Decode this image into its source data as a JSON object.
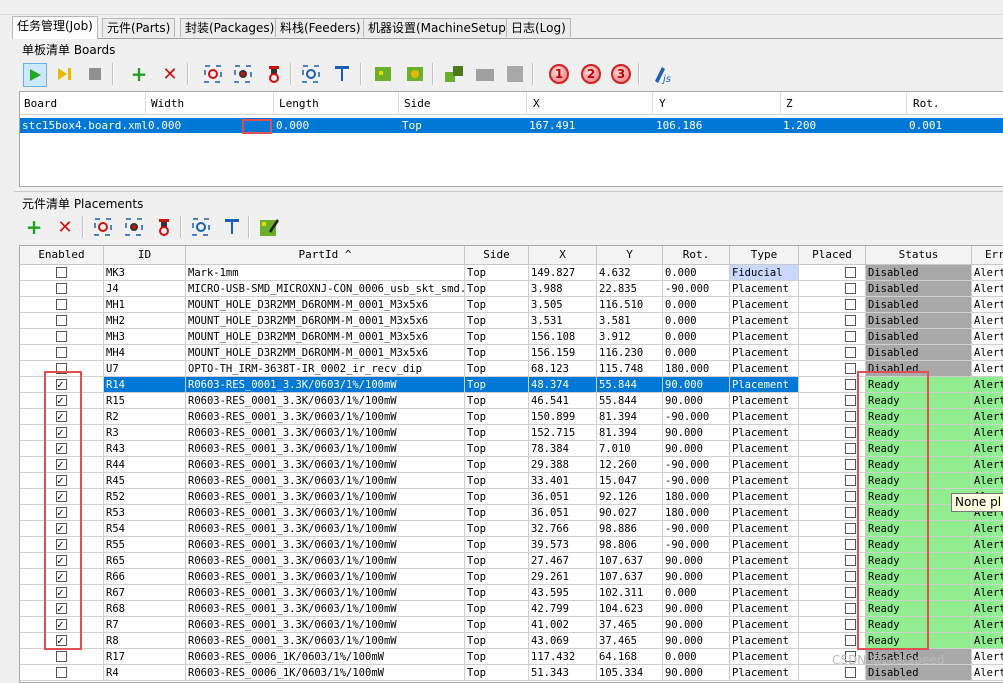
{
  "tabs": [
    "任务管理(Job)",
    "元件(Parts)",
    "封装(Packages)",
    "料栈(Feeders)",
    "机器设置(MachineSetup)",
    "日志(Log)"
  ],
  "boards_panel": {
    "title": "单板清单 Boards",
    "columns": [
      "Board",
      "Width",
      "Length",
      "Side",
      "X",
      "Y",
      "Z",
      "Rot."
    ],
    "row": [
      "stc15box4.board.xml",
      "0.000",
      "",
      "0.000",
      "Top",
      "167.491",
      "106.186",
      "1.200",
      "0.001"
    ]
  },
  "placements_panel": {
    "title": "元件清单 Placements",
    "columns": [
      "Enabled",
      "ID",
      "PartId ^",
      "Side",
      "X",
      "Y",
      "Rot.",
      "Type",
      "Placed",
      "Status",
      "Error"
    ],
    "rows": [
      {
        "enabled": false,
        "id": "MK3",
        "part": "Mark-1mm",
        "side": "Top",
        "x": "149.827",
        "y": "4.632",
        "rot": "0.000",
        "type": "Fiducial",
        "placed": false,
        "status": "Disabled",
        "error": "Alert"
      },
      {
        "enabled": false,
        "id": "J4",
        "part": "MICRO-USB-SMD_MICROXNJ-CON_0006_usb_skt_smd...",
        "side": "Top",
        "x": "3.988",
        "y": "22.835",
        "rot": "-90.000",
        "type": "Placement",
        "placed": false,
        "status": "Disabled",
        "error": "Alert"
      },
      {
        "enabled": false,
        "id": "MH1",
        "part": "MOUNT_HOLE_D3R2MM_D6ROMM-M_0001_M3x5x6",
        "side": "Top",
        "x": "3.505",
        "y": "116.510",
        "rot": "0.000",
        "type": "Placement",
        "placed": false,
        "status": "Disabled",
        "error": "Alert"
      },
      {
        "enabled": false,
        "id": "MH2",
        "part": "MOUNT_HOLE_D3R2MM_D6ROMM-M_0001_M3x5x6",
        "side": "Top",
        "x": "3.531",
        "y": "3.581",
        "rot": "0.000",
        "type": "Placement",
        "placed": false,
        "status": "Disabled",
        "error": "Alert"
      },
      {
        "enabled": false,
        "id": "MH3",
        "part": "MOUNT_HOLE_D3R2MM_D6ROMM-M_0001_M3x5x6",
        "side": "Top",
        "x": "156.108",
        "y": "3.912",
        "rot": "0.000",
        "type": "Placement",
        "placed": false,
        "status": "Disabled",
        "error": "Alert"
      },
      {
        "enabled": false,
        "id": "MH4",
        "part": "MOUNT_HOLE_D3R2MM_D6ROMM-M_0001_M3x5x6",
        "side": "Top",
        "x": "156.159",
        "y": "116.230",
        "rot": "0.000",
        "type": "Placement",
        "placed": false,
        "status": "Disabled",
        "error": "Alert"
      },
      {
        "enabled": false,
        "id": "U7",
        "part": "OPTO-TH_IRM-3638T-IR_0002_ir_recv_dip",
        "side": "Top",
        "x": "68.123",
        "y": "115.748",
        "rot": "180.000",
        "type": "Placement",
        "placed": false,
        "status": "Disabled",
        "error": "Alert"
      },
      {
        "enabled": true,
        "id": "R14",
        "part": "R0603-RES_0001_3.3K/0603/1%/100mW",
        "side": "Top",
        "x": "48.374",
        "y": "55.844",
        "rot": "90.000",
        "type": "Placement",
        "placed": false,
        "status": "Ready",
        "error": "Alert",
        "selected": true
      },
      {
        "enabled": true,
        "id": "R15",
        "part": "R0603-RES_0001_3.3K/0603/1%/100mW",
        "side": "Top",
        "x": "46.541",
        "y": "55.844",
        "rot": "90.000",
        "type": "Placement",
        "placed": false,
        "status": "Ready",
        "error": "Alert"
      },
      {
        "enabled": true,
        "id": "R2",
        "part": "R0603-RES_0001_3.3K/0603/1%/100mW",
        "side": "Top",
        "x": "150.899",
        "y": "81.394",
        "rot": "-90.000",
        "type": "Placement",
        "placed": false,
        "status": "Ready",
        "error": "Alert"
      },
      {
        "enabled": true,
        "id": "R3",
        "part": "R0603-RES_0001_3.3K/0603/1%/100mW",
        "side": "Top",
        "x": "152.715",
        "y": "81.394",
        "rot": "90.000",
        "type": "Placement",
        "placed": false,
        "status": "Ready",
        "error": "Alert"
      },
      {
        "enabled": true,
        "id": "R43",
        "part": "R0603-RES_0001_3.3K/0603/1%/100mW",
        "side": "Top",
        "x": "78.384",
        "y": "7.010",
        "rot": "90.000",
        "type": "Placement",
        "placed": false,
        "status": "Ready",
        "error": "Alert"
      },
      {
        "enabled": true,
        "id": "R44",
        "part": "R0603-RES_0001_3.3K/0603/1%/100mW",
        "side": "Top",
        "x": "29.388",
        "y": "12.260",
        "rot": "-90.000",
        "type": "Placement",
        "placed": false,
        "status": "Ready",
        "error": "Alert"
      },
      {
        "enabled": true,
        "id": "R45",
        "part": "R0603-RES_0001_3.3K/0603/1%/100mW",
        "side": "Top",
        "x": "33.401",
        "y": "15.047",
        "rot": "-90.000",
        "type": "Placement",
        "placed": false,
        "status": "Ready",
        "error": "Alert"
      },
      {
        "enabled": true,
        "id": "R52",
        "part": "R0603-RES_0001_3.3K/0603/1%/100mW",
        "side": "Top",
        "x": "36.051",
        "y": "92.126",
        "rot": "180.000",
        "type": "Placement",
        "placed": false,
        "status": "Ready",
        "error": "Alert"
      },
      {
        "enabled": true,
        "id": "R53",
        "part": "R0603-RES_0001_3.3K/0603/1%/100mW",
        "side": "Top",
        "x": "36.051",
        "y": "90.027",
        "rot": "180.000",
        "type": "Placement",
        "placed": false,
        "status": "Ready",
        "error": "Alert"
      },
      {
        "enabled": true,
        "id": "R54",
        "part": "R0603-RES_0001_3.3K/0603/1%/100mW",
        "side": "Top",
        "x": "32.766",
        "y": "98.886",
        "rot": "-90.000",
        "type": "Placement",
        "placed": false,
        "status": "Ready",
        "error": "Alert"
      },
      {
        "enabled": true,
        "id": "R55",
        "part": "R0603-RES_0001_3.3K/0603/1%/100mW",
        "side": "Top",
        "x": "39.573",
        "y": "98.806",
        "rot": "-90.000",
        "type": "Placement",
        "placed": false,
        "status": "Ready",
        "error": "Alert"
      },
      {
        "enabled": true,
        "id": "R65",
        "part": "R0603-RES_0001_3.3K/0603/1%/100mW",
        "side": "Top",
        "x": "27.467",
        "y": "107.637",
        "rot": "90.000",
        "type": "Placement",
        "placed": false,
        "status": "Ready",
        "error": "Alert"
      },
      {
        "enabled": true,
        "id": "R66",
        "part": "R0603-RES_0001_3.3K/0603/1%/100mW",
        "side": "Top",
        "x": "29.261",
        "y": "107.637",
        "rot": "90.000",
        "type": "Placement",
        "placed": false,
        "status": "Ready",
        "error": "Alert"
      },
      {
        "enabled": true,
        "id": "R67",
        "part": "R0603-RES_0001_3.3K/0603/1%/100mW",
        "side": "Top",
        "x": "43.595",
        "y": "102.311",
        "rot": "0.000",
        "type": "Placement",
        "placed": false,
        "status": "Ready",
        "error": "Alert"
      },
      {
        "enabled": true,
        "id": "R68",
        "part": "R0603-RES_0001_3.3K/0603/1%/100mW",
        "side": "Top",
        "x": "42.799",
        "y": "104.623",
        "rot": "90.000",
        "type": "Placement",
        "placed": false,
        "status": "Ready",
        "error": "Alert"
      },
      {
        "enabled": true,
        "id": "R7",
        "part": "R0603-RES_0001_3.3K/0603/1%/100mW",
        "side": "Top",
        "x": "41.002",
        "y": "37.465",
        "rot": "90.000",
        "type": "Placement",
        "placed": false,
        "status": "Ready",
        "error": "Alert"
      },
      {
        "enabled": true,
        "id": "R8",
        "part": "R0603-RES_0001_3.3K/0603/1%/100mW",
        "side": "Top",
        "x": "43.069",
        "y": "37.465",
        "rot": "90.000",
        "type": "Placement",
        "placed": false,
        "status": "Ready",
        "error": "Alert"
      },
      {
        "enabled": false,
        "id": "R17",
        "part": "R0603-RES_0006_1K/0603/1%/100mW",
        "side": "Top",
        "x": "117.432",
        "y": "64.168",
        "rot": "0.000",
        "type": "Placement",
        "placed": false,
        "status": "Disabled",
        "error": "Alert"
      },
      {
        "enabled": false,
        "id": "R4",
        "part": "R0603-RES_0006_1K/0603/1%/100mW",
        "side": "Top",
        "x": "51.343",
        "y": "105.334",
        "rot": "90.000",
        "type": "Placement",
        "placed": false,
        "status": "Disabled",
        "error": "Alert"
      }
    ]
  },
  "tooltip": "None pl",
  "watermark": "CSDN @LostSpeed",
  "colors": {
    "selection": "#0078d7",
    "ready": "#90ee90",
    "disabled": "#a8a8a8",
    "highlight": "#e05050"
  },
  "toolbar_numbers": [
    "1",
    "2",
    "3"
  ]
}
